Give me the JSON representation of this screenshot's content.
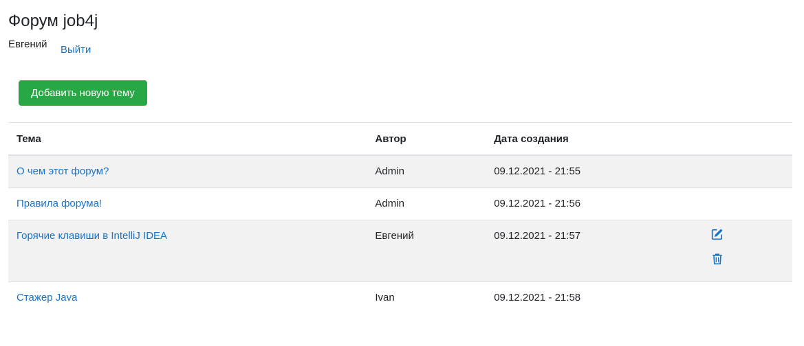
{
  "header": {
    "title": "Форум job4j",
    "user_name": "Евгений",
    "logout_label": "Выйти"
  },
  "toolbar": {
    "add_topic_label": "Добавить новую тему"
  },
  "table": {
    "columns": [
      "Тема",
      "Автор",
      "Дата создания",
      ""
    ],
    "rows": [
      {
        "topic": "О чем этот форум?",
        "author": "Admin",
        "created": "09.12.2021 - 21:55"
      },
      {
        "topic": "Правила форума!",
        "author": "Admin",
        "created": "09.12.2021 - 21:56"
      },
      {
        "topic": "Горячие клавиши в IntelliJ IDEA",
        "author": "Евгений",
        "created": "09.12.2021 - 21:57",
        "actions": [
          "edit-icon",
          "trash-icon"
        ]
      },
      {
        "topic": "Стажер Java",
        "author": "Ivan",
        "created": "09.12.2021 - 21:58"
      }
    ]
  },
  "colors": {
    "link": "#1a73c8",
    "primary_button": "#28a745",
    "stripe": "#f2f2f2"
  }
}
